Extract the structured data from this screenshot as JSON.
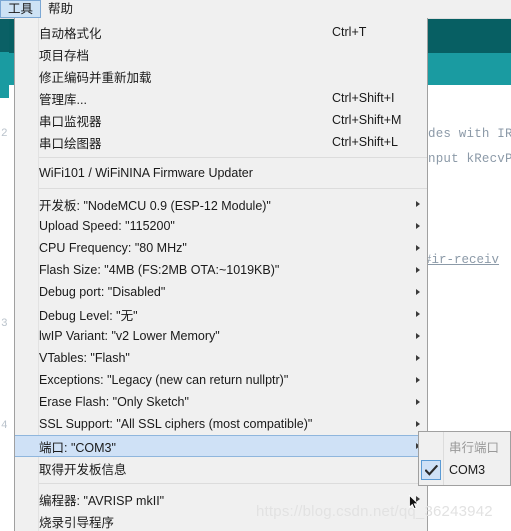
{
  "menubar": {
    "items": [
      {
        "label": "工具",
        "active": true
      },
      {
        "label": "帮助",
        "active": false
      }
    ]
  },
  "background": {
    "code_lines": [
      "des with IR",
      "nput kRecvP"
    ],
    "link_text": "#ir-receiv",
    "side_fragments": [
      "2",
      "3",
      "4"
    ]
  },
  "menu": {
    "groups": [
      {
        "items": [
          {
            "label": "自动格式化",
            "shortcut": "Ctrl+T",
            "submenu": false,
            "selected": false
          },
          {
            "label": "项目存档",
            "shortcut": "",
            "submenu": false,
            "selected": false
          },
          {
            "label": "修正编码并重新加载",
            "shortcut": "",
            "submenu": false,
            "selected": false
          },
          {
            "label": "管理库...",
            "shortcut": "Ctrl+Shift+I",
            "submenu": false,
            "selected": false
          },
          {
            "label": "串口监视器",
            "shortcut": "Ctrl+Shift+M",
            "submenu": false,
            "selected": false
          },
          {
            "label": "串口绘图器",
            "shortcut": "Ctrl+Shift+L",
            "submenu": false,
            "selected": false
          }
        ]
      },
      {
        "items": [
          {
            "label": "WiFi101 / WiFiNINA Firmware Updater",
            "shortcut": "",
            "submenu": false,
            "selected": false
          }
        ]
      },
      {
        "items": [
          {
            "label": "开发板: \"NodeMCU 0.9 (ESP-12 Module)\"",
            "shortcut": "",
            "submenu": true,
            "selected": false
          },
          {
            "label": "Upload Speed: \"115200\"",
            "shortcut": "",
            "submenu": true,
            "selected": false
          },
          {
            "label": "CPU Frequency: \"80 MHz\"",
            "shortcut": "",
            "submenu": true,
            "selected": false
          },
          {
            "label": "Flash Size: \"4MB (FS:2MB OTA:~1019KB)\"",
            "shortcut": "",
            "submenu": true,
            "selected": false
          },
          {
            "label": "Debug port: \"Disabled\"",
            "shortcut": "",
            "submenu": true,
            "selected": false
          },
          {
            "label": "Debug Level: \"无\"",
            "shortcut": "",
            "submenu": true,
            "selected": false
          },
          {
            "label": "lwIP Variant: \"v2 Lower Memory\"",
            "shortcut": "",
            "submenu": true,
            "selected": false
          },
          {
            "label": "VTables: \"Flash\"",
            "shortcut": "",
            "submenu": true,
            "selected": false
          },
          {
            "label": "Exceptions: \"Legacy (new can return nullptr)\"",
            "shortcut": "",
            "submenu": true,
            "selected": false
          },
          {
            "label": "Erase Flash: \"Only Sketch\"",
            "shortcut": "",
            "submenu": true,
            "selected": false
          },
          {
            "label": "SSL Support: \"All SSL ciphers (most compatible)\"",
            "shortcut": "",
            "submenu": true,
            "selected": false
          },
          {
            "label": "端口: \"COM3\"",
            "shortcut": "",
            "submenu": true,
            "selected": true
          },
          {
            "label": "取得开发板信息",
            "shortcut": "",
            "submenu": false,
            "selected": false
          }
        ]
      },
      {
        "items": [
          {
            "label": "编程器: \"AVRISP mkII\"",
            "shortcut": "",
            "submenu": true,
            "selected": false
          },
          {
            "label": "烧录引导程序",
            "shortcut": "",
            "submenu": false,
            "selected": false
          }
        ]
      }
    ]
  },
  "submenu": {
    "items": [
      {
        "label": "串行端口",
        "checked": false,
        "disabled": true
      },
      {
        "label": "COM3",
        "checked": true,
        "disabled": false
      }
    ]
  },
  "watermark": {
    "text": "https://blog.csdn.net/qq_36243942"
  },
  "colors": {
    "menu_bg": "#f0f0f0",
    "selection": "#cfe1f6",
    "selection_border": "#8fb6dd",
    "toolbar_dark": "#075f63",
    "toolbar_light": "#1a9ba1",
    "watermark": "#e2e2e2"
  }
}
